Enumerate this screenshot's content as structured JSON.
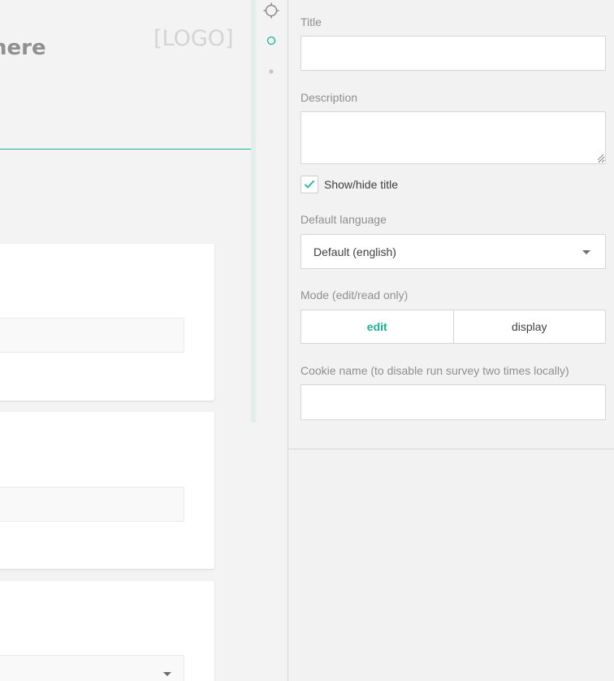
{
  "survey": {
    "title_fragment": "here",
    "logo": "[LOGO]"
  },
  "properties": {
    "title": {
      "label": "Title",
      "value": ""
    },
    "description": {
      "label": "Description",
      "value": ""
    },
    "show_title": {
      "label": "Show/hide title",
      "checked": true
    },
    "default_language": {
      "label": "Default language",
      "value": "Default (english)"
    },
    "mode": {
      "label": "Mode (edit/read only)",
      "options": [
        "edit",
        "display"
      ],
      "selected": "edit"
    },
    "cookie_name": {
      "label": "Cookie name (to disable run survey two times locally)",
      "value": ""
    }
  },
  "icons": [
    "crosshair-icon",
    "circle-outline-icon",
    "dot-icon",
    "checkmark-icon",
    "dropdown-arrow-icon"
  ],
  "colors": {
    "accent": "#1ab394",
    "panel_bg": "#f2f2f2",
    "label": "#8f8f8f"
  }
}
